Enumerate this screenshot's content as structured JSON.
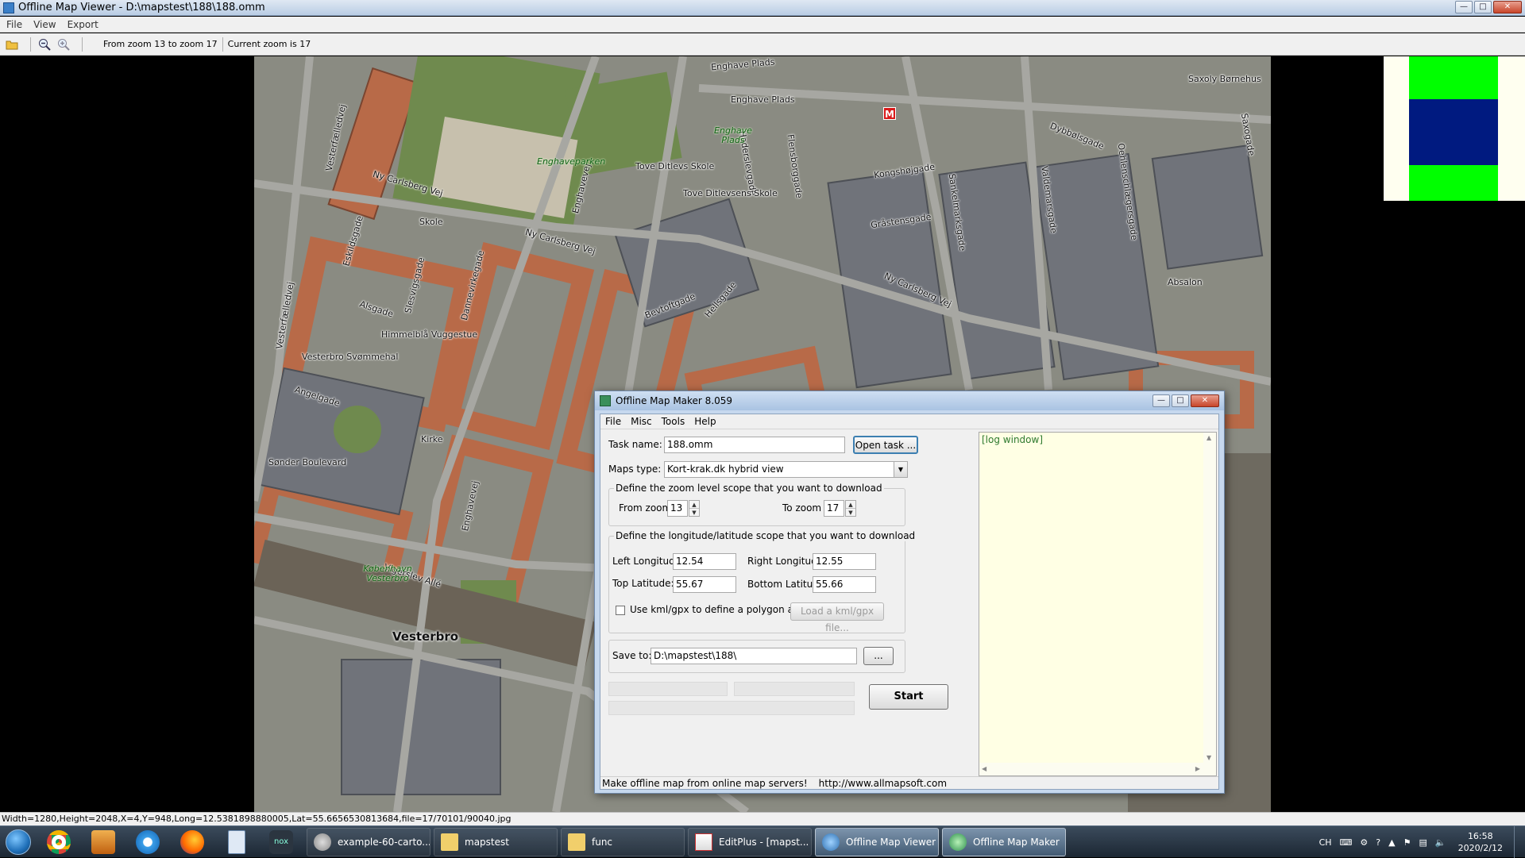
{
  "viewer": {
    "title": "Offline Map Viewer - D:\\mapstest\\188\\188.omm",
    "menu": [
      "File",
      "View",
      "Export"
    ],
    "toolbar": {
      "zoom_range_text": "From zoom 13 to zoom 17",
      "current_zoom_text": "Current zoom is 17"
    },
    "statusbar": "Width=1280,Height=2048,X=4,Y=948,Long=12.5381898880005,Lat=55.6656530813684,file=17/70101/90040.jpg"
  },
  "map": {
    "street_labels": [
      "Enghave Plads",
      "Saxoly Børnehus",
      "Dybbølsgade",
      "Saxogade",
      "Ny Carlsberg Vej",
      "Vesterfælledvej",
      "Kongshøjgade",
      "Gråstensgade",
      "Flensborggade",
      "Sankelmarksgade",
      "Valdemarsgade",
      "Oehlenschlægersgade",
      "Haderslevgade",
      "Ny Carlsberg Vej",
      "Ny Carlsberg Vej",
      "Bevtoftgade",
      "Hellsgade",
      "Absalon",
      "Skole",
      "Eskildsgade",
      "Slesvigsgade",
      "Dannevirkegade",
      "Alsgade",
      "Himmelblå Vuggestue",
      "Vesterbro Svømmehal",
      "Angelgade",
      "Kirke",
      "Sønder Boulevard",
      "Vigerslev Allé",
      "Tove Ditlevs Skole",
      "Tove Ditlevsens Skole",
      "Enghave Plads",
      "Vesterfælledvej",
      "Enghavevej",
      "Enghavevej"
    ],
    "park_labels": [
      "Enghaveparken",
      "Enghave Plads",
      "København Vesterbro"
    ],
    "district_label": "Vesterbro",
    "metro_label": "M"
  },
  "maker": {
    "title": "Offline Map Maker 8.059",
    "menu": [
      "File",
      "Misc",
      "Tools",
      "Help"
    ],
    "task_name_label": "Task name:",
    "task_name_value": "188.omm",
    "open_task_label": "Open task ...",
    "maps_type_label": "Maps type:",
    "maps_type_value": "Kort-krak.dk hybrid view",
    "zoom_group_legend": "Define the zoom level scope that you want to download",
    "from_zoom_label": "From zoom",
    "from_zoom_value": "13",
    "to_zoom_label": "To zoom",
    "to_zoom_value": "17",
    "coord_group_legend": "Define the longitude/latitude scope that you want to download",
    "left_lon_label": "Left Longitude:",
    "left_lon_value": "12.54",
    "right_lon_label": "Right Longitude:",
    "right_lon_value": "12.55",
    "top_lat_label": "Top Latitude:",
    "top_lat_value": "55.67",
    "bottom_lat_label": "Bottom Latitude:",
    "bottom_lat_value": "55.66",
    "kml_checkbox_label": "Use kml/gpx to define a polygon area",
    "load_kml_label": "Load a kml/gpx file...",
    "save_to_label": "Save to:",
    "save_to_value": "D:\\mapstest\\188\\",
    "browse_label": "...",
    "start_label": "Start",
    "log_text": "[log window]",
    "status_left": "Make offline map from online map servers!",
    "status_url": "http://www.allmapsoft.com"
  },
  "taskbar": {
    "tasks": [
      {
        "label": "example-60-carto...",
        "active": false
      },
      {
        "label": "mapstest",
        "active": false
      },
      {
        "label": "func",
        "active": false
      },
      {
        "label": "EditPlus - [mapst...",
        "active": false
      },
      {
        "label": "Offline Map Viewer",
        "active": true
      },
      {
        "label": "Offline Map Maker",
        "active": true
      }
    ],
    "tray_lang": "CH",
    "clock_time": "16:58",
    "clock_date": "2020/2/12"
  },
  "colors": {
    "preview_top": "#00ff00",
    "preview_mid": "#001a80",
    "preview_bottom": "#00ff00"
  }
}
